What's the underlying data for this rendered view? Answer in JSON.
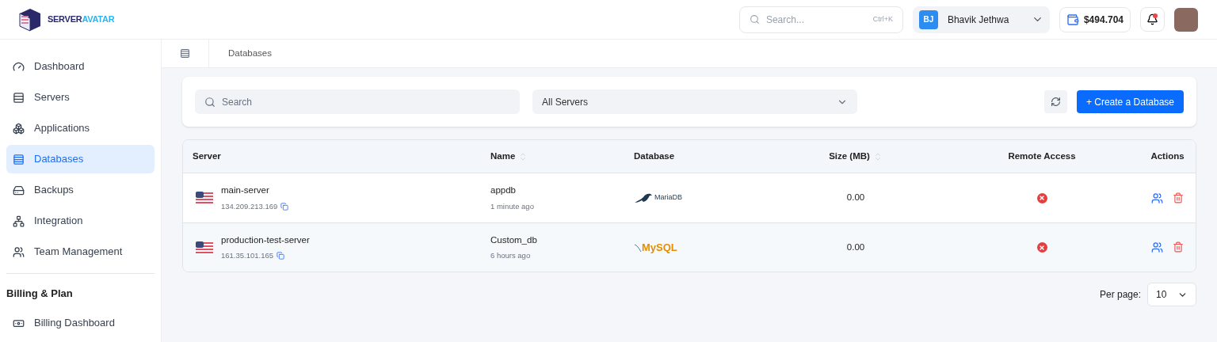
{
  "logo": {
    "part1": "SERVER",
    "part2": "AVATAR"
  },
  "header": {
    "search": {
      "placeholder": "Search...",
      "shortcut": "Ctrl+K"
    },
    "user": {
      "initials": "BJ",
      "name": "Bhavik Jethwa"
    },
    "balance": "$494.704",
    "notification": true
  },
  "sidebar": {
    "items": [
      {
        "label": "Dashboard",
        "selected": false
      },
      {
        "label": "Servers",
        "selected": false
      },
      {
        "label": "Applications",
        "selected": false
      },
      {
        "label": "Databases",
        "selected": true
      },
      {
        "label": "Backups",
        "selected": false
      },
      {
        "label": "Integration",
        "selected": false
      },
      {
        "label": "Team Management",
        "selected": false
      }
    ],
    "section": "Billing & Plan",
    "section_items": [
      {
        "label": "Billing Dashboard",
        "selected": false
      }
    ]
  },
  "breadcrumb": "Databases",
  "filters": {
    "search_placeholder": "Search",
    "server_select": "All Servers",
    "create_button": "+ Create a Database"
  },
  "table": {
    "columns": [
      {
        "label": "Server",
        "sortable": false
      },
      {
        "label": "Name",
        "sortable": true
      },
      {
        "label": "Database",
        "sortable": false
      },
      {
        "label": "Size (MB)",
        "sortable": true
      },
      {
        "label": "Remote Access",
        "sortable": false
      },
      {
        "label": "Actions",
        "sortable": false
      }
    ],
    "rows": [
      {
        "server": "main-server",
        "ip": "134.209.213.169",
        "name": "appdb",
        "time": "1 minute ago",
        "kind": "mariadb",
        "db_label": "MariaDB",
        "size": "0.00",
        "remote_access": false
      },
      {
        "server": "production-test-server",
        "ip": "161.35.101.165",
        "name": "Custom_db",
        "time": "6 hours ago",
        "kind": "mysql",
        "db_label": "MySQL",
        "size": "0.00",
        "remote_access": false
      }
    ]
  },
  "pagination": {
    "label": "Per page:",
    "value": "10"
  }
}
